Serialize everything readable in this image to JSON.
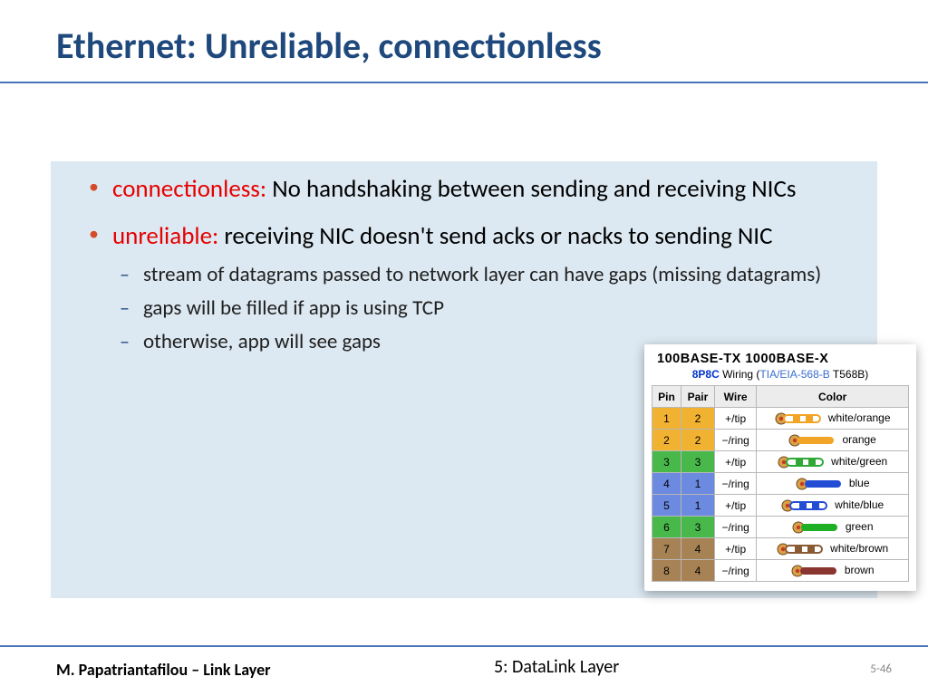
{
  "title": "Ethernet: Unreliable, connectionless",
  "bullets": [
    {
      "keyword": "connectionless:",
      "text": " No handshaking between sending and receiving NICs"
    },
    {
      "keyword": "unreliable:",
      "text": " receiving NIC doesn't send acks or nacks to sending NIC"
    }
  ],
  "subbullets": [
    "stream of datagrams passed to network layer can have gaps (missing datagrams)",
    "gaps will be filled if app is using TCP",
    "otherwise, app will see gaps"
  ],
  "wiring": {
    "header": "100BASE-TX   1000BASE-X",
    "sub_blue": "8P8C",
    "sub_black": " Wiring (",
    "sub_link": "TIA/EIA-568-B",
    "sub_after": " T568B)",
    "cols": {
      "pin": "Pin",
      "pair": "Pair",
      "wire": "Wire",
      "color": "Color"
    },
    "rows": [
      {
        "pin": "1",
        "pair": "2",
        "wire": "+/tip",
        "color": "white/orange",
        "pinbg": "#f2b231",
        "pairbg": "#f2b231",
        "stripe": "#f2a426"
      },
      {
        "pin": "2",
        "pair": "2",
        "wire": "−/ring",
        "color": "orange",
        "pinbg": "#f2b231",
        "pairbg": "#f2b231",
        "solid": "#f2a426"
      },
      {
        "pin": "3",
        "pair": "3",
        "wire": "+/tip",
        "color": "white/green",
        "pinbg": "#49b84b",
        "pairbg": "#49b84b",
        "stripe": "#2fa836"
      },
      {
        "pin": "4",
        "pair": "1",
        "wire": "−/ring",
        "color": "blue",
        "pinbg": "#6b8ae0",
        "pairbg": "#6b8ae0",
        "solid": "#244dd6"
      },
      {
        "pin": "5",
        "pair": "1",
        "wire": "+/tip",
        "color": "white/blue",
        "pinbg": "#6b8ae0",
        "pairbg": "#6b8ae0",
        "stripe": "#244dd6"
      },
      {
        "pin": "6",
        "pair": "3",
        "wire": "−/ring",
        "color": "green",
        "pinbg": "#49b84b",
        "pairbg": "#49b84b",
        "solid": "#1eaf24"
      },
      {
        "pin": "7",
        "pair": "4",
        "wire": "+/tip",
        "color": "white/brown",
        "pinbg": "#a78255",
        "pairbg": "#a78255",
        "stripe": "#8a5a32"
      },
      {
        "pin": "8",
        "pair": "4",
        "wire": "−/ring",
        "color": "brown",
        "pinbg": "#a78255",
        "pairbg": "#a78255",
        "solid": "#8a3530"
      }
    ]
  },
  "footer": {
    "left": "M. Papatriantafilou –  Link Layer",
    "center": "5: DataLink Layer",
    "right": "5-46"
  }
}
